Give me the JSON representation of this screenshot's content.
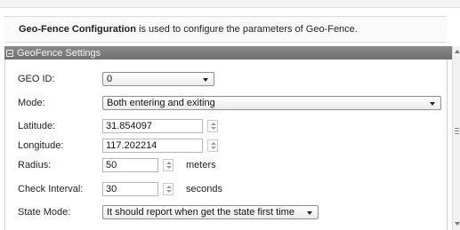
{
  "header": {
    "title_bold": "Geo-Fence Configuration",
    "title_rest": " is used to configure the parameters of Geo-Fence."
  },
  "section": {
    "title": "GeoFence Settings"
  },
  "fields": {
    "geo_id": {
      "label": "GEO ID:",
      "value": "0"
    },
    "mode": {
      "label": "Mode:",
      "value": "Both entering and exiting"
    },
    "latitude": {
      "label": "Latitude:",
      "value": "31.854097"
    },
    "longitude": {
      "label": "Longitude:",
      "value": "117.202214"
    },
    "radius": {
      "label": "Radius:",
      "value": "50",
      "unit": "meters"
    },
    "check_interval": {
      "label": "Check Interval:",
      "value": "30",
      "unit": "seconds"
    },
    "state_mode": {
      "label": "State Mode:",
      "value": "It should report when get the state first time"
    }
  },
  "icons": {
    "collapse": "minus-box-icon",
    "dropdown": "chevron-down-icon",
    "spinner": "spinner-arrows-icon"
  },
  "colors": {
    "section_bar": "#7d7d7d",
    "panel_border": "#cfcfcf"
  }
}
